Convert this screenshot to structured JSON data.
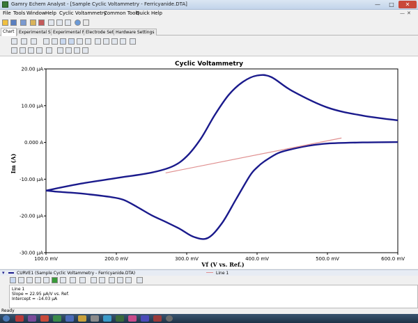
{
  "window": {
    "title": "Gamry Echem Analyst - [Sample Cyclic Voltammetry - Ferricyanide.DTA]",
    "minimize_icon": "minimize-icon",
    "maximize_icon": "maximize-icon",
    "close_icon": "close-icon"
  },
  "menu": {
    "items": [
      "File",
      "Tools",
      "Window",
      "Help",
      "Cyclic Voltammetry",
      "Common Tools",
      "Quick Help"
    ]
  },
  "tabs": [
    "Chart",
    "Experimental Setup",
    "Experimental Notes",
    "Electrode Settings",
    "Hardware Settings"
  ],
  "chart_data": {
    "type": "line",
    "title": "Cyclic Voltammetry",
    "xlabel": "Vf (V vs. Ref.)",
    "ylabel": "Im (A)",
    "xlim": [
      100,
      600
    ],
    "ylim": [
      -30,
      20
    ],
    "x_ticks": [
      "100.0 mV",
      "200.0 mV",
      "300.0 mV",
      "400.0 mV",
      "500.0 mV",
      "600.0 mV"
    ],
    "x_tick_values": [
      100,
      200,
      300,
      400,
      500,
      600
    ],
    "y_ticks": [
      "20.00 µA",
      "10.00 µA",
      "0.000 A",
      "-10.00 µA",
      "-20.00 µA",
      "-30.00 µA"
    ],
    "y_tick_values": [
      20,
      10,
      0,
      -10,
      -20,
      -30
    ],
    "grid": false,
    "series": [
      {
        "name": "CURVE1",
        "color": "#1a1a8c",
        "x": [
          100,
          150,
          200,
          250,
          280,
          300,
          320,
          340,
          360,
          380,
          400,
          420,
          450,
          500,
          550,
          600
        ],
        "y": [
          -13.1,
          -11.2,
          -9.7,
          -8.2,
          -6.5,
          -3.8,
          1.0,
          7.5,
          13.0,
          16.5,
          18.2,
          17.8,
          14.0,
          9.5,
          7.3,
          6.0
        ]
      },
      {
        "name": "CURVE1",
        "color": "#1a1a8c",
        "x": [
          600,
          550,
          500,
          470,
          450,
          430,
          410,
          400,
          390,
          370,
          350,
          330,
          310,
          290,
          270,
          250,
          230,
          210,
          190,
          150,
          130,
          115,
          100
        ],
        "y": [
          0.1,
          0.0,
          -0.3,
          -1.0,
          -1.8,
          -2.9,
          -5.2,
          -6.8,
          -9.0,
          -15.5,
          -22.0,
          -26.0,
          -25.7,
          -23.5,
          -21.6,
          -19.8,
          -17.6,
          -15.6,
          -14.8,
          -13.9,
          -13.6,
          -13.4,
          -13.1
        ]
      },
      {
        "name": "Line 1",
        "color": "#e09090",
        "x": [
          270,
          520
        ],
        "y": [
          -8.3,
          1.2
        ]
      }
    ]
  },
  "legend": {
    "curve_label": "CURVE1 (Sample Cyclic Voltammetry - Ferricyanide.DTA)",
    "line_label": "Line 1"
  },
  "notes": {
    "line1": "Line 1",
    "line2": "Slope = 22.95 µA/V vs. Ref.",
    "line3": "Intercept = -14.03 µA"
  },
  "status": "Ready"
}
